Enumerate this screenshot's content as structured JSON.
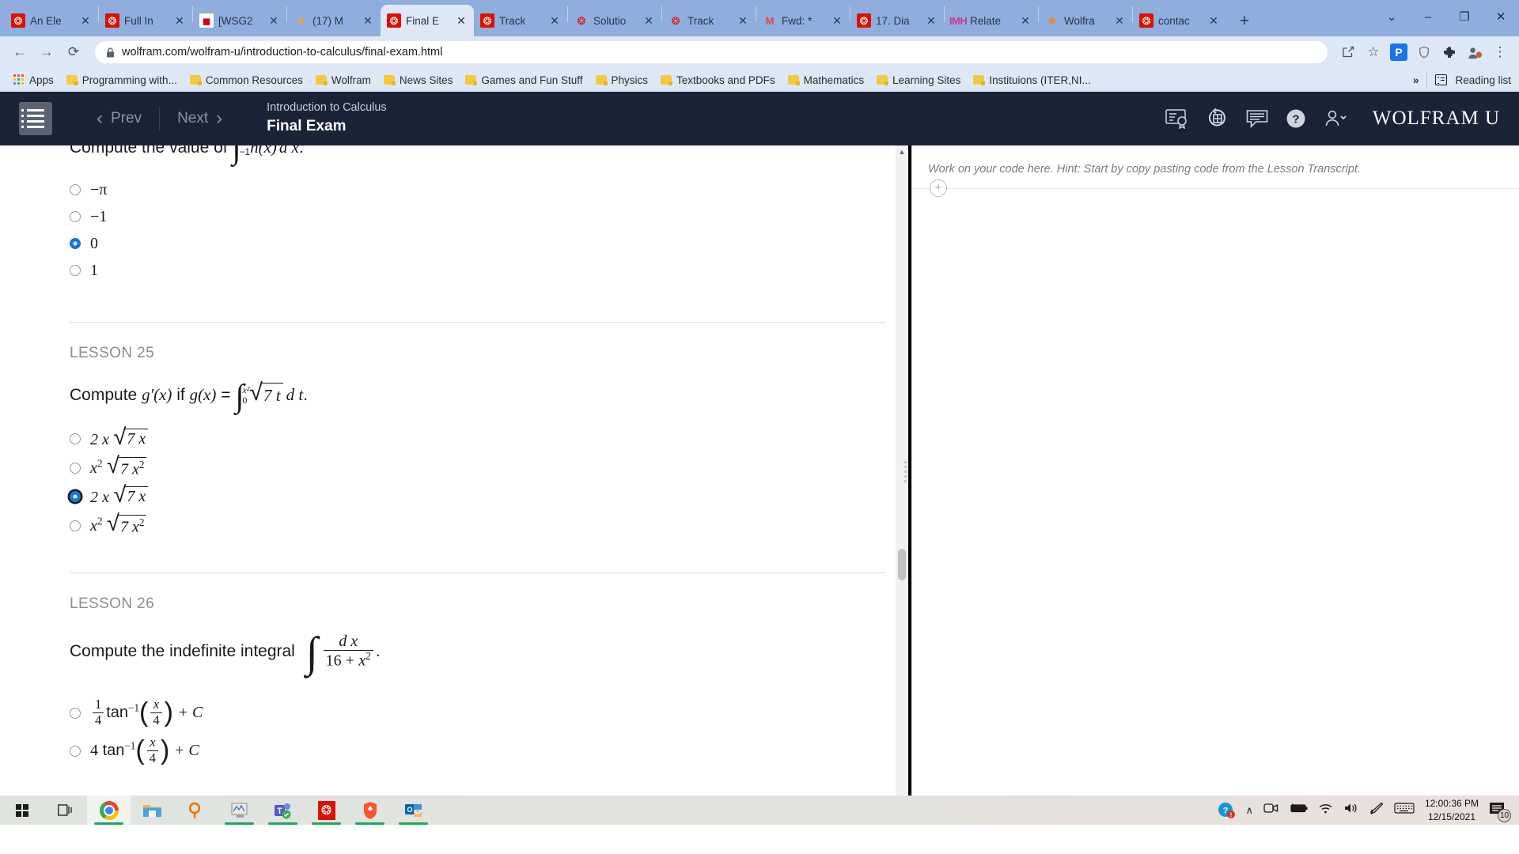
{
  "browser": {
    "tabs": [
      {
        "label": "An Ele",
        "icon": "wolfram-icon",
        "active": false
      },
      {
        "label": "Full In",
        "icon": "wolfram-icon",
        "active": false
      },
      {
        "label": "[WSG2",
        "icon": "pdf-icon",
        "active": false
      },
      {
        "label": "(17) M",
        "icon": "sun-icon",
        "active": false
      },
      {
        "label": "Final E",
        "icon": "wolfram-icon",
        "active": true
      },
      {
        "label": "Track",
        "icon": "wolfram-icon",
        "active": false
      },
      {
        "label": "Solutio",
        "icon": "wolfram-icon",
        "active": false
      },
      {
        "label": "Track",
        "icon": "wolfram-icon",
        "active": false
      },
      {
        "label": "Fwd: *",
        "icon": "gmail-icon",
        "active": false
      },
      {
        "label": "17. Dia",
        "icon": "wolfram-icon",
        "active": false
      },
      {
        "label": "Relate",
        "icon": "mathhelp-icon",
        "active": false
      },
      {
        "label": "Wolfra",
        "icon": "orange-sun-icon",
        "active": false
      },
      {
        "label": "contac",
        "icon": "wolfram-icon",
        "active": false
      }
    ],
    "new_tab_label": "+",
    "window_controls": {
      "minimize": "–",
      "maximize": "❐",
      "close": "✕",
      "tabsearch": "⌄"
    },
    "toolbar": {
      "back": "←",
      "forward": "→",
      "reload": "⟳",
      "url": "wolfram.com/wolfram-u/introduction-to-calculus/final-exam.html",
      "lock_icon": "lock-icon",
      "share": "share-icon",
      "bookmark_star": "☆",
      "profile_letter": "P",
      "shield": "shield-icon",
      "extensions": "puzzle-icon",
      "avatar": "avatar-icon",
      "menu": "⋮"
    },
    "bookmarks": {
      "apps_label": "Apps",
      "items": [
        "Programming with...",
        "Common Resources",
        "Wolfram",
        "News Sites",
        "Games and Fun Stuff",
        "Physics",
        "Textbooks and PDFs",
        "Mathematics",
        "Learning Sites",
        "Instituions (ITER,NI..."
      ],
      "overflow": "»",
      "reading_list": "Reading list"
    }
  },
  "wolfram_header": {
    "menu_icon": "list-menu-icon",
    "prev_label": "Prev",
    "next_label": "Next",
    "prev_chevron": "‹",
    "next_chevron": "›",
    "course_name": "Introduction to Calculus",
    "course_title": "Final Exam",
    "icons": [
      "certificate-icon",
      "scroll-refresh-icon",
      "transcript-icon",
      "help-icon",
      "account-icon"
    ],
    "brand": "WOLFRAM U"
  },
  "quiz": {
    "question_top": {
      "prompt_prefix": "Compute the value of",
      "integral_lower": "−1",
      "integrand": "h(x)",
      "differential": "d x",
      "trailing": ".",
      "options": [
        {
          "text": "−π",
          "selected": false
        },
        {
          "text": "−1",
          "selected": false
        },
        {
          "text": "0",
          "selected": true
        },
        {
          "text": "1",
          "selected": false
        }
      ]
    },
    "lesson25": {
      "lesson_label": "LESSON 25",
      "prompt_a": "Compute",
      "prompt_g_prime": "g'",
      "prompt_x1": "(x)",
      "prompt_if": "if",
      "prompt_gx": "g(x)",
      "equals": "=",
      "int_upper": "x²",
      "int_lower": "0",
      "radicand": "7 t",
      "dt": "d t",
      "period": ".",
      "options": [
        {
          "coef": "2 x",
          "radicand": "7 x",
          "exp": "",
          "rad_exp": "",
          "selected": false,
          "focused": false
        },
        {
          "coef": "x",
          "coef_exp": "2",
          "radicand": "7 x",
          "rad_exp": "2",
          "selected": false,
          "focused": false
        },
        {
          "coef": "2 x",
          "radicand": "7 x",
          "exp": "",
          "rad_exp": "",
          "selected": true,
          "focused": true
        },
        {
          "coef": "x",
          "coef_exp": "2",
          "radicand": "7 x",
          "rad_exp": "2",
          "selected": false,
          "focused": false
        }
      ]
    },
    "lesson26": {
      "lesson_label": "LESSON 26",
      "prompt": "Compute the indefinite integral",
      "numerator": "d x",
      "denominator_a": "16 +",
      "denominator_x": "x",
      "denominator_exp": "2",
      "period": ".",
      "options": [
        {
          "frac_num": "1",
          "frac_den": "4",
          "fn": "tan",
          "fn_exp": "−1",
          "arg_num": "x",
          "arg_den": "4",
          "tail": "+ C",
          "selected": false
        },
        {
          "coef": "4",
          "fn": "tan",
          "fn_exp": "−1",
          "arg_num": "x",
          "arg_den": "4",
          "tail": "+ C",
          "selected": false
        }
      ]
    }
  },
  "code_panel": {
    "hint": "Work on your code here. Hint: Start by copy pasting code from the Lesson Transcript.",
    "add_cell": "+"
  },
  "taskbar": {
    "start": "windows-start-icon",
    "task_view": "task-view-icon",
    "apps": [
      {
        "name": "chrome-icon",
        "active": true,
        "running": true
      },
      {
        "name": "file-explorer-icon",
        "active": false,
        "running": false
      },
      {
        "name": "search-magnifier-icon",
        "active": false,
        "running": false
      },
      {
        "name": "notebook-icon",
        "active": false,
        "running": true
      },
      {
        "name": "teams-icon",
        "active": false,
        "running": true
      },
      {
        "name": "mathematica-icon",
        "active": false,
        "running": true
      },
      {
        "name": "brave-icon",
        "active": false,
        "running": true
      },
      {
        "name": "outlook-icon",
        "active": false,
        "running": true
      }
    ],
    "tray": {
      "help_badge": "help-alert-icon",
      "chevron_up": "∧",
      "camera": "camera-icon",
      "battery": "battery-icon",
      "wifi": "wifi-icon",
      "volume": "volume-icon",
      "pen": "pen-icon",
      "keyboard": "keyboard-icon",
      "time": "12:00:36 PM",
      "date": "12/15/2021",
      "notifications_count": "10"
    }
  },
  "colors": {
    "chrome_tabstrip": "#8faede",
    "chrome_toolbar": "#dee7f6",
    "wolfram_header": "#1b2437",
    "accent_blue": "#1675e0",
    "wolfram_red": "#dd1100",
    "taskbar_green": "#1aa85c"
  }
}
